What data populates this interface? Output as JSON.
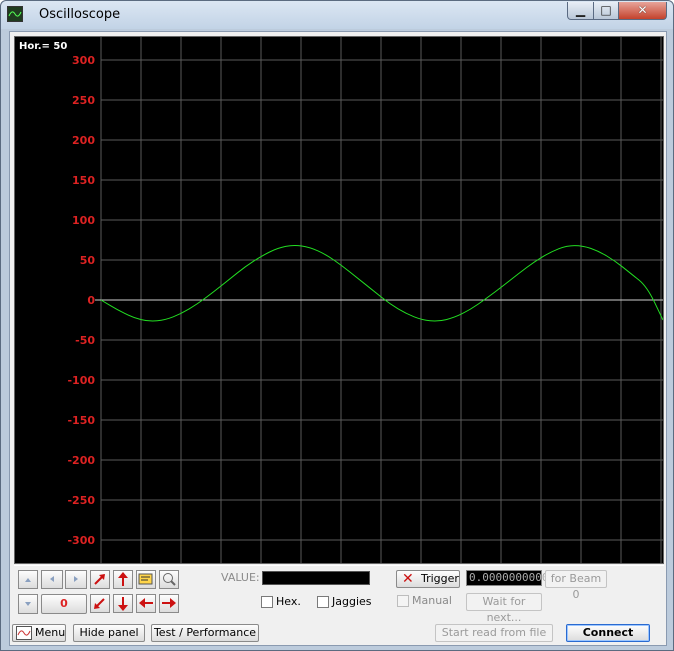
{
  "window": {
    "title": "Oscilloscope",
    "min_symbol": "▁",
    "max_symbol": "□",
    "close_symbol": "✕"
  },
  "scope": {
    "horizontal_readout": "Hor.=  50",
    "colors": {
      "background": "#000000",
      "grid": "#5a5a5a",
      "zero_line": "#d0d0d0",
      "trace": "#22dd22",
      "axis_labels": "#dd2222"
    }
  },
  "chart_data": {
    "type": "line",
    "title": "",
    "xlabel": "",
    "ylabel": "",
    "y_ticks": [
      300,
      250,
      200,
      150,
      100,
      50,
      0,
      -50,
      -100,
      -150,
      -200,
      -250,
      -300
    ],
    "ylim": [
      -330,
      330
    ],
    "xlim": [
      0,
      700
    ],
    "grid": true,
    "series": [
      {
        "x": [
          0,
          20,
          40,
          60,
          80,
          100,
          120,
          140,
          160,
          180,
          200,
          220,
          240,
          260,
          280,
          300,
          320,
          340,
          360,
          380,
          400,
          420,
          440,
          460,
          480,
          500,
          520,
          540,
          560,
          580,
          600,
          620,
          640,
          660,
          680,
          700
        ],
        "values": [
          0,
          -12,
          -22,
          -27,
          -25,
          -17,
          -5,
          10,
          26,
          42,
          55,
          65,
          69,
          66,
          57,
          43,
          27,
          11,
          -5,
          -17,
          -25,
          -27,
          -22,
          -12,
          2,
          17,
          33,
          48,
          60,
          68,
          68,
          61,
          49,
          33,
          17,
          -25
        ]
      }
    ]
  },
  "controls": {
    "value_label": "VALUE:",
    "counter": "0",
    "hex_label": "Hex.",
    "jaggies_label": "Jaggies",
    "trigger_label": "Trigger",
    "trigger_value": "0.0000000000",
    "for_beam_label": "for Beam 0",
    "manual_label": "Manual",
    "wait_label": "Wait for next..."
  },
  "bottom_bar": {
    "menu_label": "Menu",
    "hide_panel_label": "Hide panel",
    "test_label": "Test / Performance",
    "start_read_label": "Start read from file",
    "connect_label": "Connect"
  }
}
